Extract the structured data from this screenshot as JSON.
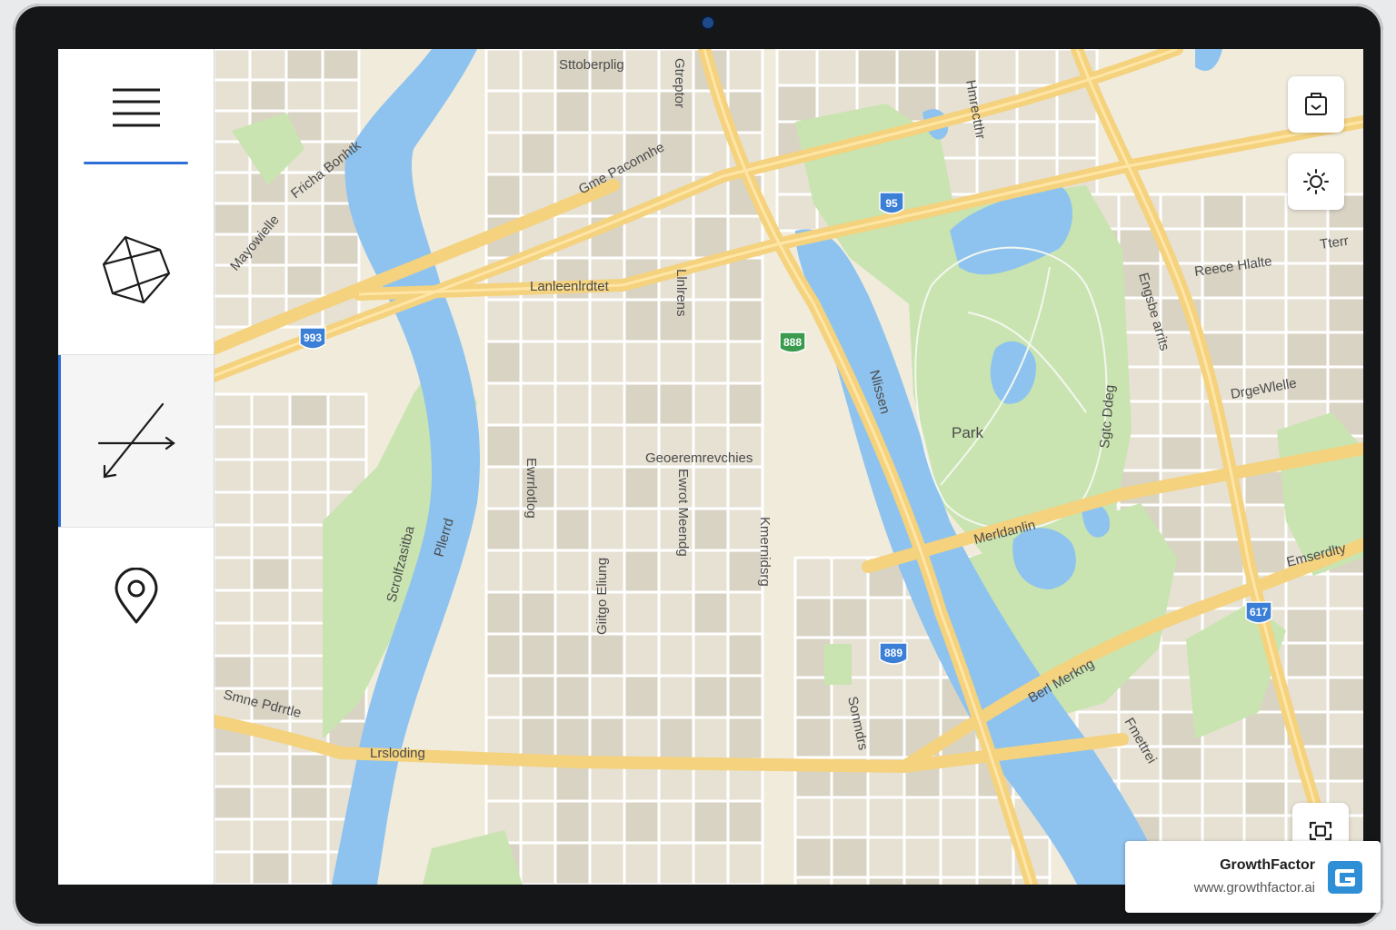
{
  "map": {
    "streets": {
      "top_center": "Sttoberplig",
      "top_vertical": "Gtreptor",
      "upper_left_diag": "Fricha Bonhtk",
      "left_diag": "Mayowielle",
      "center_diag": "Gme Paconnhe",
      "middle_left": "Lanleenlrdtet",
      "center_vertical": "Llnlrens",
      "top_right_vertical": "Hmrectthr",
      "right_upper": "Reece Hlalte",
      "right_edge_top": "Tterr",
      "right_vertical_1": "Engsbe arrits",
      "right_vertical_2": "Sgtc Ddeg",
      "right_middle": "DrgeWlelle",
      "center": "Geoeremrevchies",
      "vertical_a": "Ewrrlotlog",
      "vertical_b": "Ewrot Meendg",
      "vertical_c": "Kmernidsrg",
      "vertical_d": "Giitgo Eliung",
      "left_vertical": "Scrolfzasitba",
      "river_left": "Pllerrd",
      "lower_left": "Smne Pdrrtle",
      "bottom_left": "Lrsloding",
      "river_right": "Nlissen",
      "park_road": "Merldanlin",
      "right_lower": "Emserdlty",
      "lower_right_diag": "Berl Merkng",
      "bottom_vertical": "Sonmdrs",
      "bottom_right": "Fmettrei"
    },
    "park_label": "Park",
    "shields": {
      "s1": "95",
      "s2": "993",
      "s3": "888",
      "s4": "889",
      "s5": "617"
    },
    "colors": {
      "land": "#f1ebdc",
      "block": "#e2ddcf",
      "road": "#f4d27e",
      "water": "#8ec3ef",
      "park": "#c9e4b0",
      "shield_blue": "#3b7fd6",
      "shield_green": "#3c9a4e"
    }
  },
  "sidebar": {
    "items": [
      {
        "icon": "hamburger-menu-icon",
        "selected": false
      },
      {
        "icon": "polygon-shape-icon",
        "selected": false
      },
      {
        "icon": "route-arrow-icon",
        "selected": true
      },
      {
        "icon": "location-pin-icon",
        "selected": false
      }
    ],
    "accent": "#2d6fd6"
  },
  "controls": [
    {
      "icon": "clipboard-icon"
    },
    {
      "icon": "brightness-icon"
    },
    {
      "icon": "recenter-icon"
    }
  ],
  "watermark": {
    "name": "GrowthFactor",
    "url": "www.growthfactor.ai",
    "logo_color": "#2e8fd6"
  }
}
